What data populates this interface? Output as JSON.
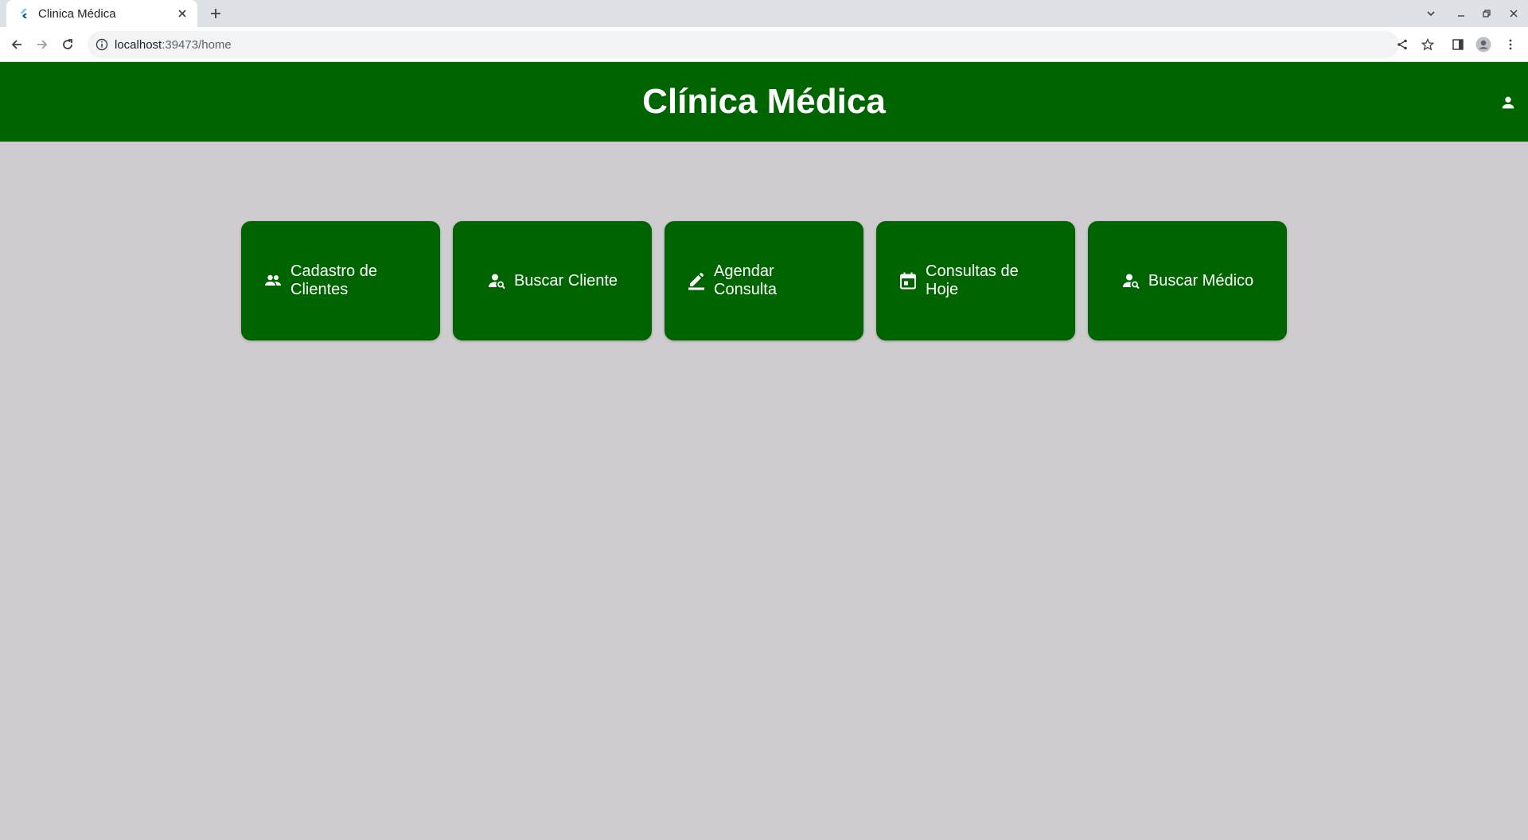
{
  "browser": {
    "tab_title": "Clinica Médica",
    "url_host": "localhost",
    "url_rest": ":39473/home"
  },
  "app": {
    "title": "Clínica Médica",
    "brand_color": "#006400",
    "background_color": "#cfcccf",
    "user_icon": "person-icon"
  },
  "menu": [
    {
      "label": "Cadastro de Clientes",
      "icon": "people-icon"
    },
    {
      "label": "Buscar Cliente",
      "icon": "person-search-icon"
    },
    {
      "label": "Agendar Consulta",
      "icon": "edit-icon"
    },
    {
      "label": "Consultas de Hoje",
      "icon": "calendar-icon"
    },
    {
      "label": "Buscar Médico",
      "icon": "person-search-icon"
    }
  ]
}
